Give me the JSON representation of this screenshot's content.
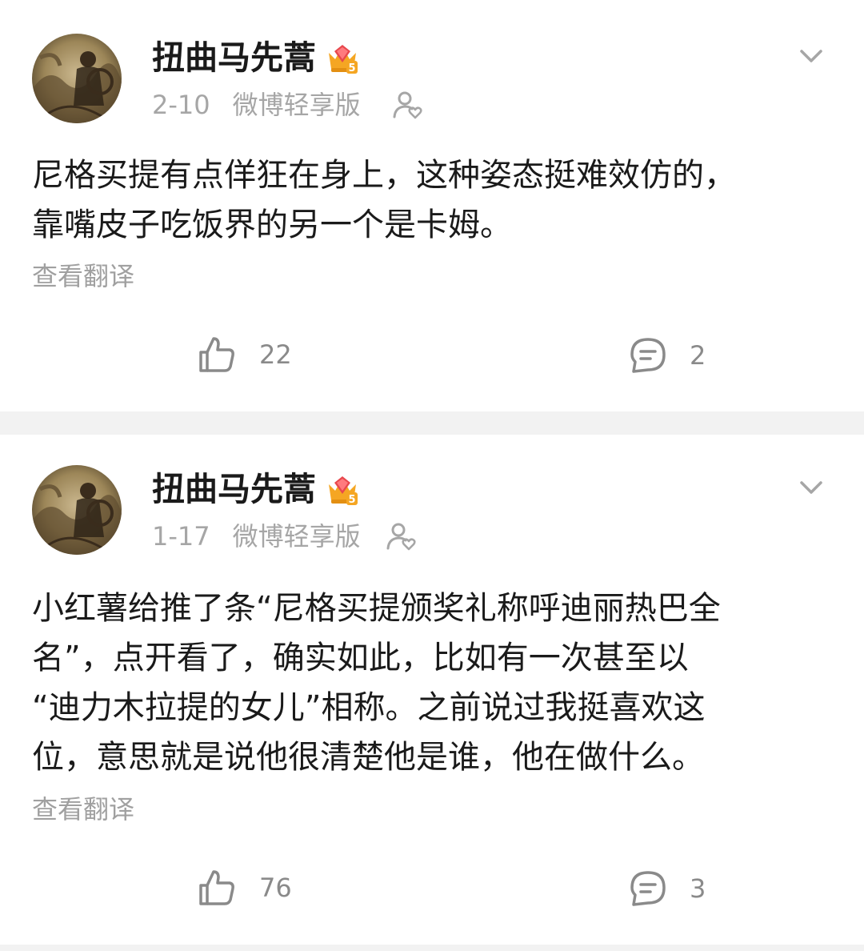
{
  "posts": [
    {
      "username": "扭曲马先蒿",
      "vip_level": "5",
      "date": "2-10",
      "source": "微博轻享版",
      "content": "尼格买提有点佯狂在身上，这种姿态挺难效仿的，\n靠嘴皮子吃饭界的另一个是卡姆。",
      "translate_label": "查看翻译",
      "likes": "22",
      "comments": "2"
    },
    {
      "username": "扭曲马先蒿",
      "vip_level": "5",
      "date": "1-17",
      "source": "微博轻享版",
      "content": "小红薯给推了条“尼格买提颁奖礼称呼迪丽热巴全\n名”，点开看了，确实如此，比如有一次甚至以\n“迪力木拉提的女儿”相称。之前说过我挺喜欢这\n位，意思就是说他很清楚他是谁，他在做什么。",
      "translate_label": "查看翻译",
      "likes": "76",
      "comments": "3"
    }
  ],
  "colors": {
    "background": "#f2f2f2",
    "card": "#ffffff",
    "text_primary": "#1a1a1a",
    "text_secondary": "#a6a6a6",
    "vip_gold": "#f5a623"
  },
  "icons": {
    "menu": "chevron-down-icon",
    "relation": "friend-visible-icon",
    "like": "thumbs-up-icon",
    "comment": "comment-bubble-icon",
    "badge": "vip-crown-badge-icon"
  }
}
